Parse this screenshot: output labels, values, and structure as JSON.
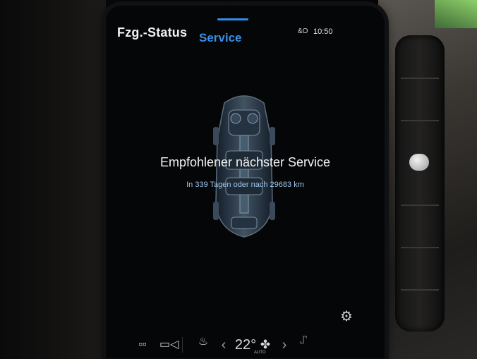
{
  "header": {
    "tab_vehicle_status": "Fzg.-Status",
    "tab_service": "Service",
    "status_icon": "&O",
    "clock": "10:50"
  },
  "service": {
    "headline": "Empfohlener nächster Service",
    "detail": "In 339 Tagen oder nach 29683 km"
  },
  "climate": {
    "temperature": "22°",
    "fan_mode": "AUTO"
  },
  "colors": {
    "accent": "#3a8fe8",
    "background": "#050608",
    "text": "#f2f2f2"
  },
  "icons": {
    "settings": "gear-icon",
    "home_tiles": "tiles-icon",
    "camera": "camera-icon",
    "seat_heat_left": "seat-heat-icon",
    "fan": "fan-icon",
    "seat_right": "seat-icon"
  }
}
